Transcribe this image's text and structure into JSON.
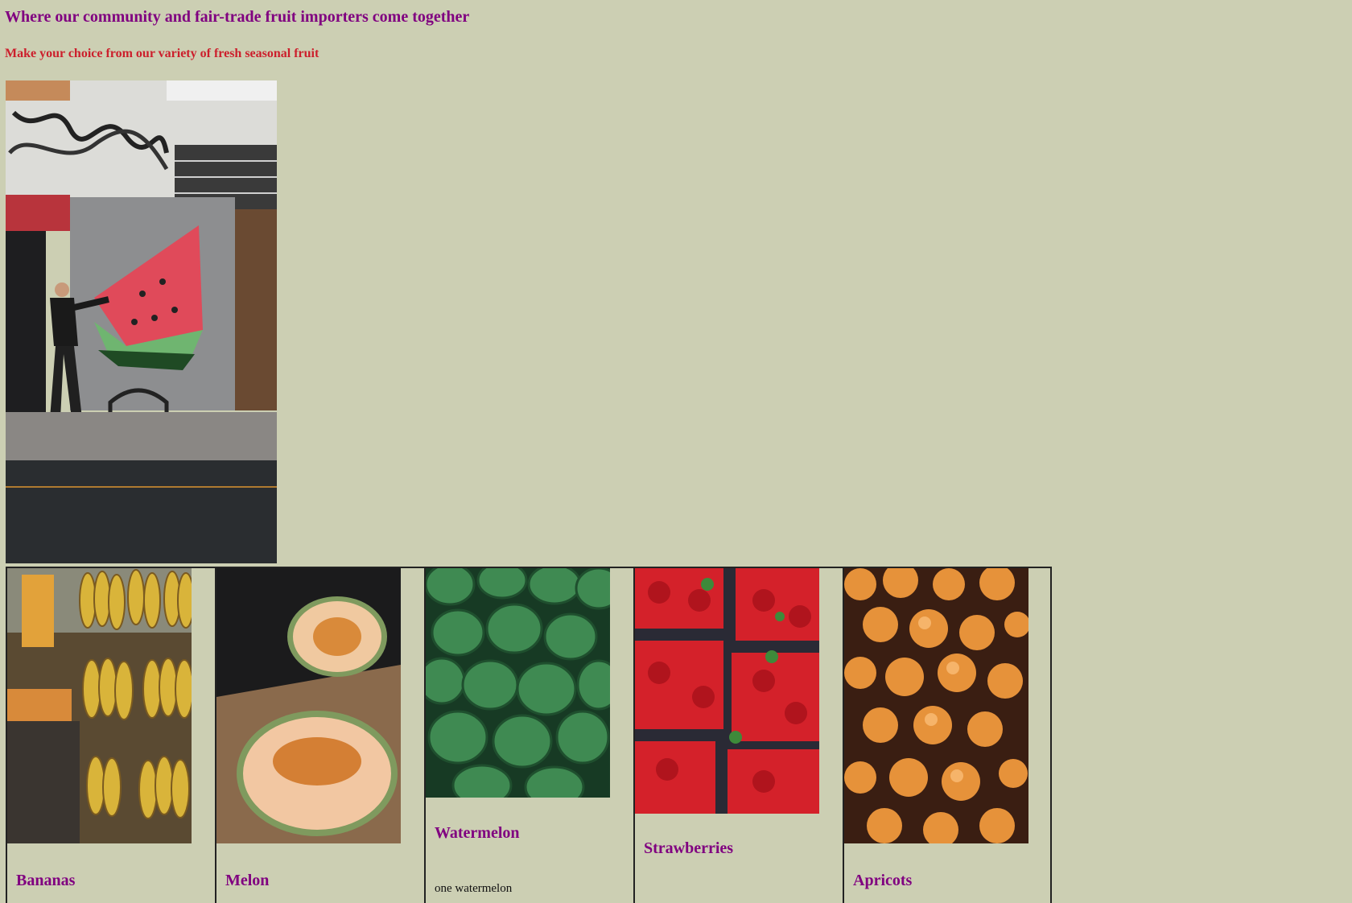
{
  "header": {
    "title": "Where our community and fair-trade fruit importers come together",
    "subtitle": "Make your choice from our variety of fresh seasonal fruit"
  },
  "hero": {
    "image": "street-mural-watermelon-photo"
  },
  "products": [
    {
      "name": "Bananas",
      "image": "bananas-photo",
      "description": ""
    },
    {
      "name": "Melon",
      "image": "melon-photo",
      "description": ""
    },
    {
      "name": "Watermelon",
      "image": "watermelons-photo",
      "description": "one watermelon"
    },
    {
      "name": "Strawberries",
      "image": "strawberries-photo",
      "description": ""
    },
    {
      "name": "Apricots",
      "image": "apricots-photo",
      "description": ""
    }
  ],
  "colors": {
    "background": "#cccfb3",
    "heading": "#800080",
    "subheading": "#cc1f2c"
  }
}
